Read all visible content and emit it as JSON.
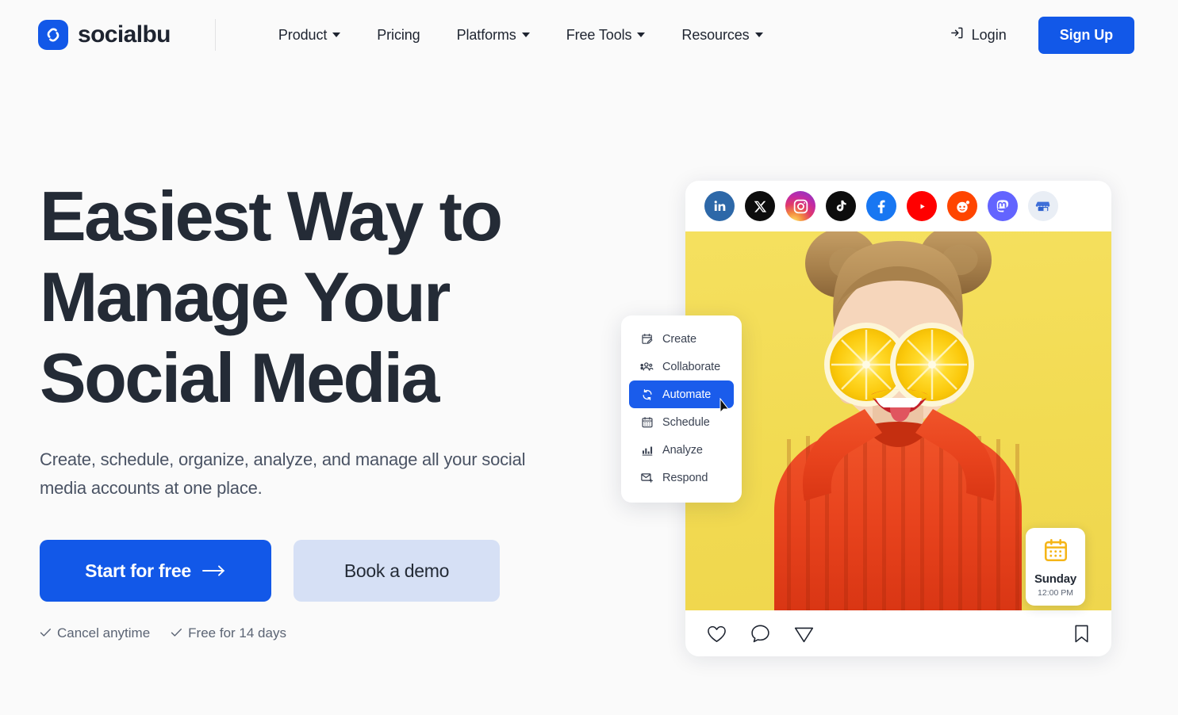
{
  "brand": {
    "name": "socialbu",
    "logo_icon": "socialbu-s-logo",
    "accent_color": "#1258e8"
  },
  "nav": {
    "items": [
      {
        "label": "Product",
        "has_dropdown": true
      },
      {
        "label": "Pricing",
        "has_dropdown": false
      },
      {
        "label": "Platforms",
        "has_dropdown": true
      },
      {
        "label": "Free Tools",
        "has_dropdown": true
      },
      {
        "label": "Resources",
        "has_dropdown": true
      }
    ],
    "login_label": "Login",
    "login_icon": "sign-in-icon",
    "signup_label": "Sign Up"
  },
  "hero": {
    "title_line1": "Easiest Way to",
    "title_line2": "Manage Your",
    "title_line3": "Social Media",
    "subtitle": "Create, schedule, organize, analyze, and manage all your social media accounts at one place.",
    "primary_cta": "Start for free",
    "primary_cta_icon": "arrow-right-icon",
    "secondary_cta": "Book a demo",
    "assurances": [
      {
        "icon": "check-icon",
        "label": "Cancel anytime"
      },
      {
        "icon": "check-icon",
        "label": "Free for 14 days"
      }
    ]
  },
  "post_card": {
    "platforms": [
      {
        "name": "LinkedIn",
        "icon": "linkedin-icon",
        "color": "#2d68a8"
      },
      {
        "name": "X",
        "icon": "x-twitter-icon",
        "color": "#0d0d0d"
      },
      {
        "name": "Instagram",
        "icon": "instagram-icon",
        "color": "#c32aa3"
      },
      {
        "name": "TikTok",
        "icon": "tiktok-icon",
        "color": "#0d0d0d"
      },
      {
        "name": "Facebook",
        "icon": "facebook-icon",
        "color": "#1877f2"
      },
      {
        "name": "YouTube",
        "icon": "youtube-icon",
        "color": "#ff0000"
      },
      {
        "name": "Reddit",
        "icon": "reddit-icon",
        "color": "#ff4500"
      },
      {
        "name": "Mastodon",
        "icon": "mastodon-icon",
        "color": "#6364ff"
      },
      {
        "name": "Google Business",
        "icon": "google-business-icon",
        "color": "#e9eef5"
      }
    ],
    "image_alt": "Woman in orange sweater holding two lemon slices over her eyes on a yellow background",
    "image_bg_color": "#f2db52",
    "actions": [
      {
        "name": "like",
        "icon": "heart-icon"
      },
      {
        "name": "comment",
        "icon": "comment-icon"
      },
      {
        "name": "share",
        "icon": "paper-plane-icon"
      },
      {
        "name": "save",
        "icon": "bookmark-icon"
      }
    ]
  },
  "float_menu": {
    "items": [
      {
        "label": "Create",
        "icon": "calendar-edit-icon",
        "active": false
      },
      {
        "label": "Collaborate",
        "icon": "users-icon",
        "active": false
      },
      {
        "label": "Automate",
        "icon": "sync-refresh-icon",
        "active": true
      },
      {
        "label": "Schedule",
        "icon": "calendar-icon",
        "active": false
      },
      {
        "label": "Analyze",
        "icon": "bar-chart-icon",
        "active": false
      },
      {
        "label": "Respond",
        "icon": "mail-reply-icon",
        "active": false
      }
    ],
    "active_color": "#1a5ceb"
  },
  "schedule_badge": {
    "icon": "calendar-icon",
    "icon_color": "#f5b518",
    "day": "Sunday",
    "time": "12:00 PM"
  }
}
